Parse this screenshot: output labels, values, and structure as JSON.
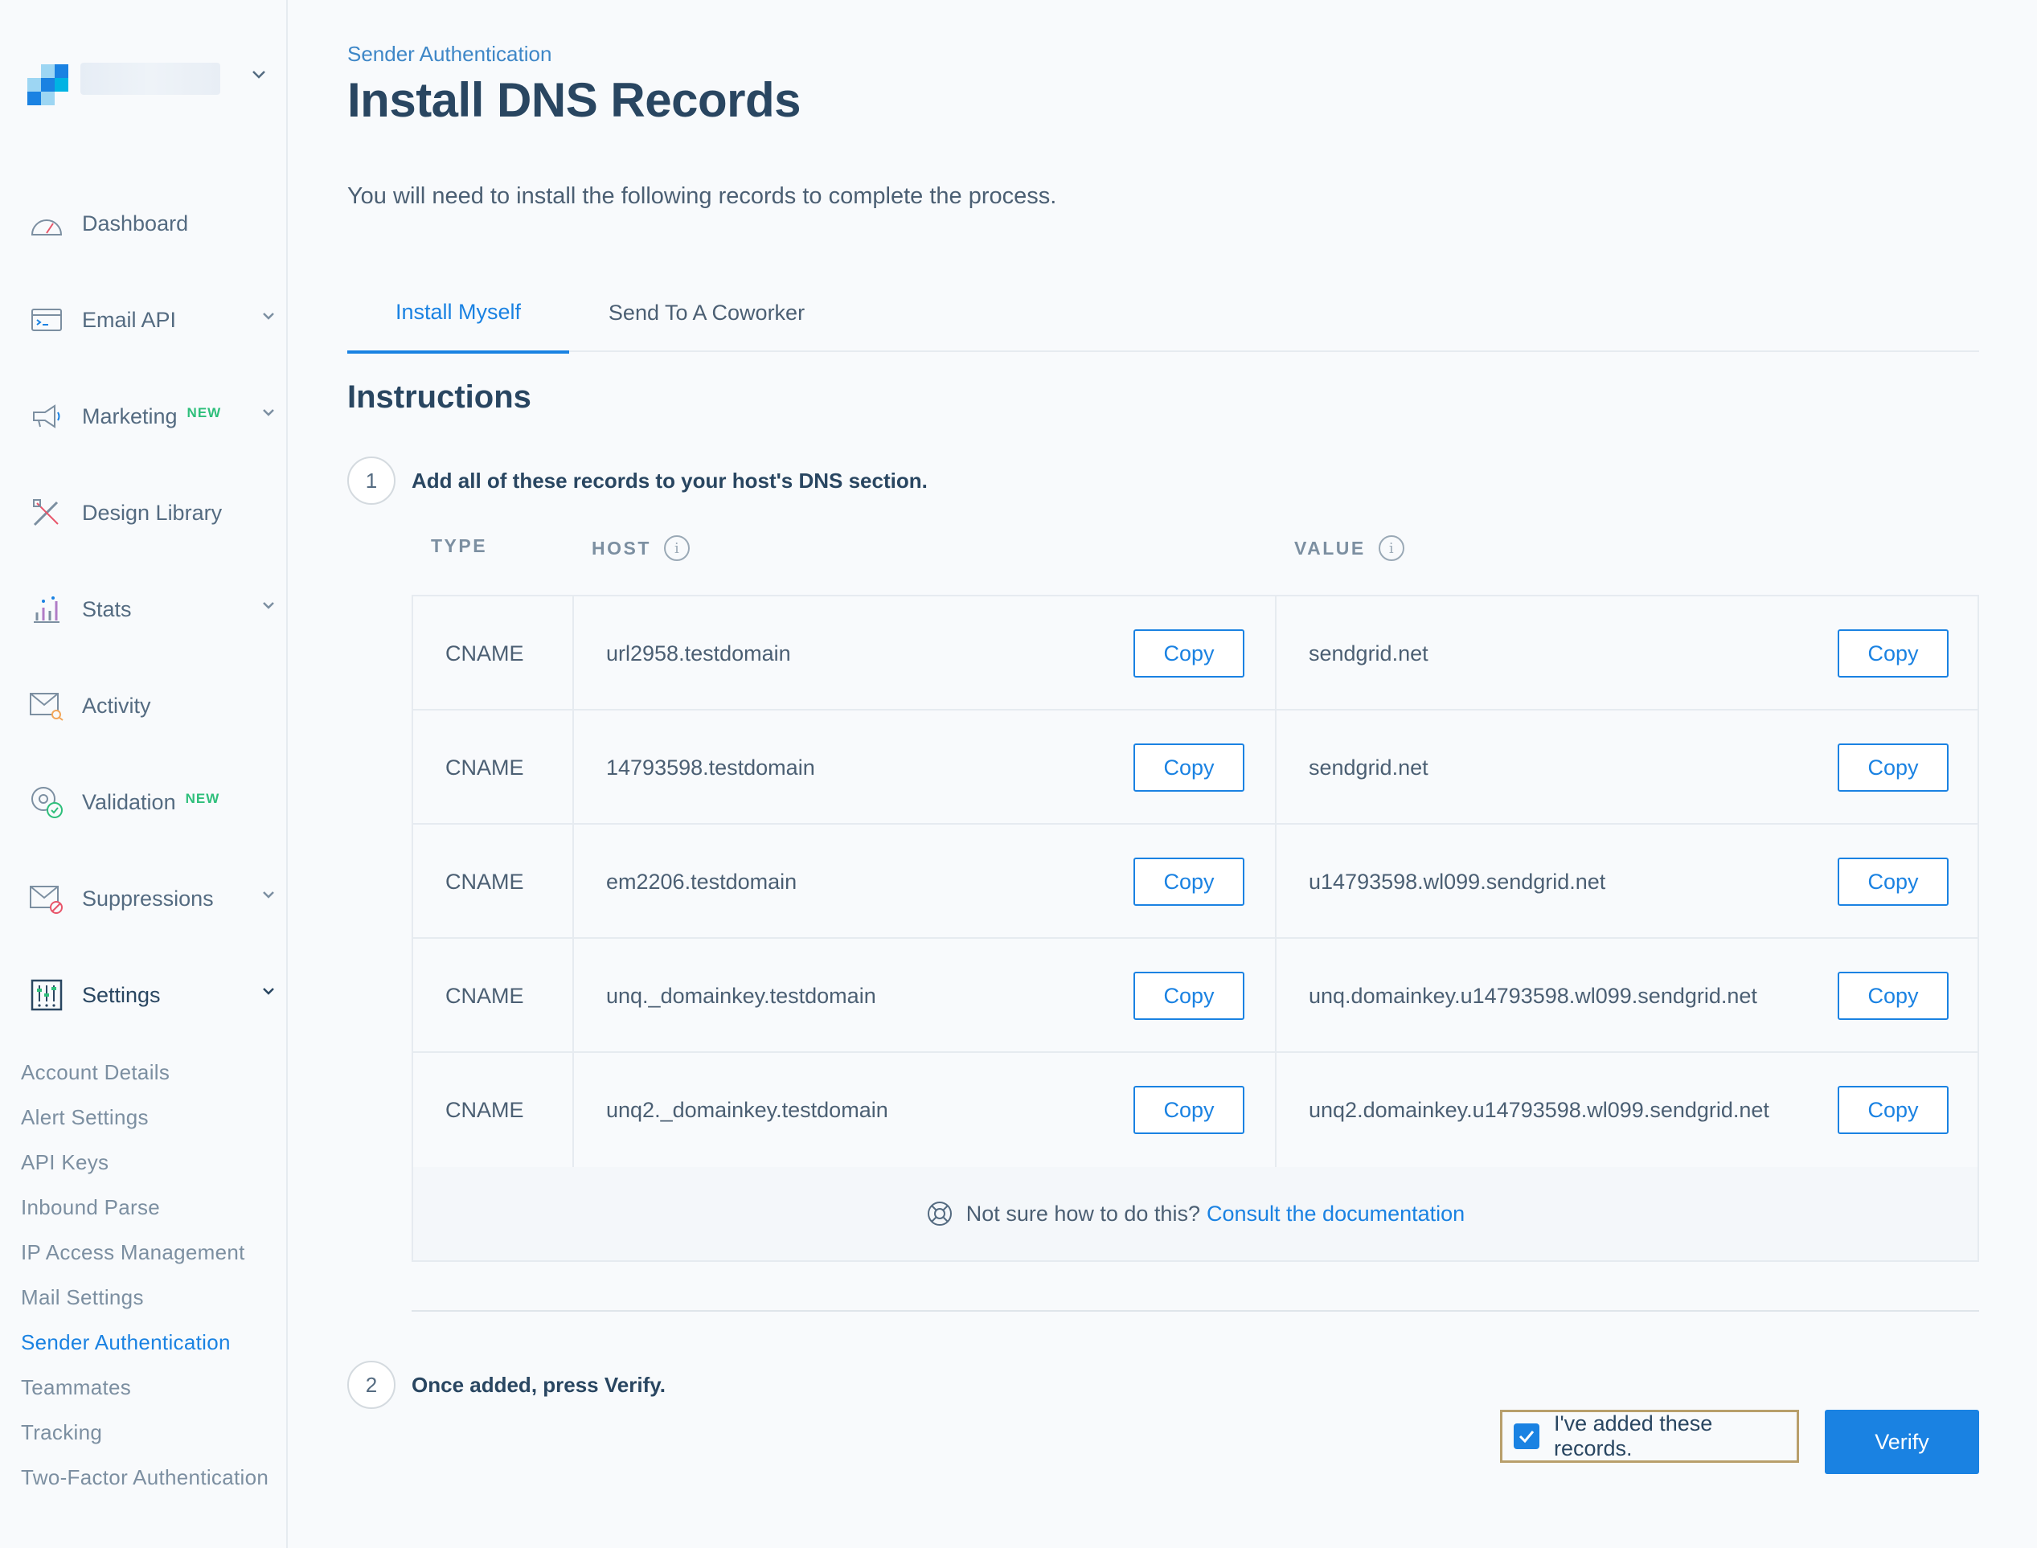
{
  "sidebar": {
    "nav": [
      {
        "label": "Dashboard",
        "icon": "dashboard-icon"
      },
      {
        "label": "Email API",
        "icon": "email-api-icon",
        "expandable": true
      },
      {
        "label": "Marketing",
        "icon": "megaphone-icon",
        "badge": "NEW",
        "expandable": true
      },
      {
        "label": "Design Library",
        "icon": "design-library-icon"
      },
      {
        "label": "Stats",
        "icon": "stats-icon",
        "expandable": true
      },
      {
        "label": "Activity",
        "icon": "activity-icon"
      },
      {
        "label": "Validation",
        "icon": "validation-icon",
        "badge": "NEW"
      },
      {
        "label": "Suppressions",
        "icon": "suppressions-icon",
        "expandable": true
      },
      {
        "label": "Settings",
        "icon": "settings-icon",
        "expandable": true,
        "active": true
      }
    ],
    "settings_items": [
      {
        "label": "Account Details"
      },
      {
        "label": "Alert Settings"
      },
      {
        "label": "API Keys"
      },
      {
        "label": "Inbound Parse"
      },
      {
        "label": "IP Access Management"
      },
      {
        "label": "Mail Settings"
      },
      {
        "label": "Sender Authentication",
        "active": true
      },
      {
        "label": "Teammates"
      },
      {
        "label": "Tracking"
      },
      {
        "label": "Two-Factor Authentication"
      }
    ]
  },
  "header": {
    "breadcrumb": "Sender Authentication",
    "title": "Install DNS Records",
    "intro": "You will need to install the following records to complete the process."
  },
  "tabs": [
    {
      "label": "Install Myself",
      "active": true
    },
    {
      "label": "Send To A Coworker",
      "active": false
    }
  ],
  "instructions": {
    "heading": "Instructions",
    "step1": {
      "number": "1",
      "text": "Add all of these records to your host's DNS section."
    },
    "step2": {
      "number": "2",
      "text": "Once added, press Verify."
    }
  },
  "table": {
    "headers": {
      "type": "TYPE",
      "host": "HOST",
      "value": "VALUE"
    },
    "copy_label": "Copy",
    "records": [
      {
        "type": "CNAME",
        "host": "url2958.testdomain",
        "value": "sendgrid.net"
      },
      {
        "type": "CNAME",
        "host": "14793598.testdomain",
        "value": "sendgrid.net"
      },
      {
        "type": "CNAME",
        "host": "em2206.testdomain",
        "value": "u14793598.wl099.sendgrid.net"
      },
      {
        "type": "CNAME",
        "host": "unq._domainkey.testdomain",
        "value": "unq.domainkey.u14793598.wl099.sendgrid.net"
      },
      {
        "type": "CNAME",
        "host": "unq2._domainkey.testdomain",
        "value": "unq2.domainkey.u14793598.wl099.sendgrid.net"
      }
    ]
  },
  "help": {
    "text": "Not sure how to do this?",
    "link": "Consult the documentation"
  },
  "confirm": {
    "label": "I've added these records.",
    "checked": true
  },
  "verify_label": "Verify",
  "colors": {
    "accent": "#1a82e2",
    "heading": "#294661",
    "badge_new": "#2ebf7b",
    "confirm_outline": "#b89f6b"
  }
}
